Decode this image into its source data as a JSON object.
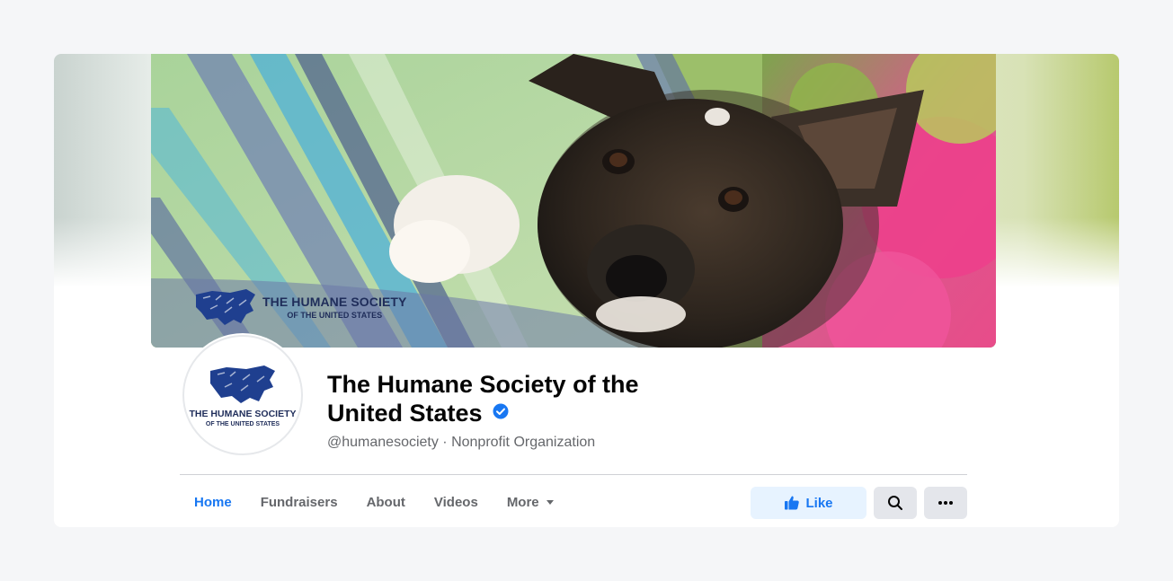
{
  "cover": {
    "logo_line1": "THE HUMANE SOCIETY",
    "logo_line2": "OF THE UNITED STATES"
  },
  "avatar": {
    "logo_line1": "THE HUMANE SOCIETY",
    "logo_line2": "OF THE UNITED STATES"
  },
  "page": {
    "name": "The Humane Society of the United States",
    "verified": true,
    "handle_and_category": "@humanesociety · Nonprofit Organization"
  },
  "tabs": [
    {
      "label": "Home",
      "active": true
    },
    {
      "label": "Fundraisers",
      "active": false
    },
    {
      "label": "About",
      "active": false
    },
    {
      "label": "Videos",
      "active": false
    },
    {
      "label": "More",
      "active": false,
      "has_dropdown": true
    }
  ],
  "actions": {
    "like_label": "Like",
    "search_icon": "search-icon",
    "more_icon": "ellipsis-icon"
  },
  "colors": {
    "accent": "#1877f2",
    "like_bg": "#e7f3ff",
    "secondary_bg": "#e4e6eb",
    "muted_text": "#65676b",
    "logo_navy": "#1f2d5a"
  }
}
